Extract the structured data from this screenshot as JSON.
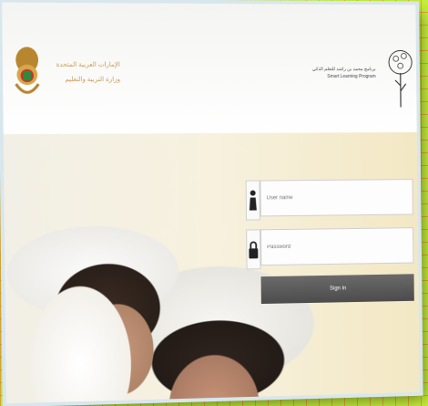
{
  "header": {
    "ministry_line1": "الإمارات العربية المتحدة",
    "ministry_line2": "وزارة التربية والتعليم",
    "program_line1": "برنامج محمد بن راشد للتعلم الذكي",
    "program_line2": "Smart Learning Program"
  },
  "login": {
    "username_placeholder": "User name",
    "password_placeholder": "Password",
    "signin_label": "Sign In"
  },
  "icons": {
    "emblem": "uae-emblem-icon",
    "tree": "tree-logo-icon",
    "user": "user-icon",
    "lock": "lock-icon"
  },
  "colors": {
    "ministry_text": "#c99a55",
    "signin_bg": "#555555"
  }
}
